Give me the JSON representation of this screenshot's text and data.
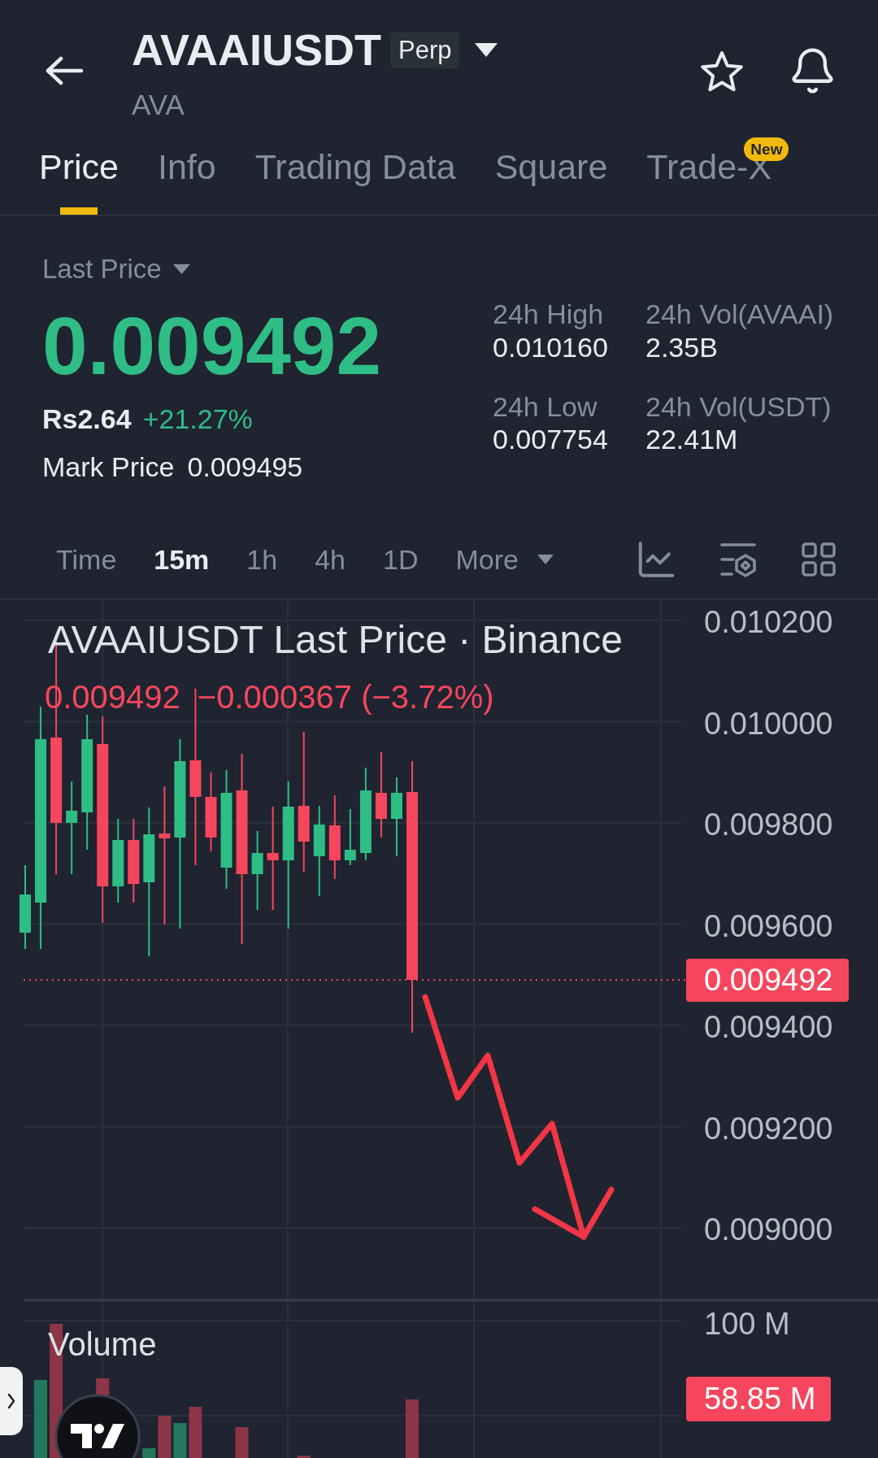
{
  "header": {
    "title": "AVAAIUSDT",
    "badge": "Perp",
    "subtitle": "AVA"
  },
  "tabs": [
    {
      "label": "Price",
      "selected": true
    },
    {
      "label": "Info",
      "selected": false
    },
    {
      "label": "Trading Data",
      "selected": false
    },
    {
      "label": "Square",
      "selected": false
    },
    {
      "label": "Trade-X",
      "selected": false,
      "badge": "New"
    }
  ],
  "price": {
    "type": "Last Price",
    "value": "0.009492",
    "fiat": "Rs2.64",
    "change": "+21.27%",
    "mark_label": "Mark Price",
    "mark_value": "0.009495"
  },
  "stats": [
    {
      "label": "24h High",
      "value": "0.010160"
    },
    {
      "label": "24h Vol(AVAAI)",
      "value": "2.35B"
    },
    {
      "label": "24h Low",
      "value": "0.007754"
    },
    {
      "label": "24h Vol(USDT)",
      "value": "22.41M"
    }
  ],
  "toolbar": {
    "label": "Time",
    "intervals": [
      {
        "label": "15m",
        "selected": true
      },
      {
        "label": "1h",
        "selected": false
      },
      {
        "label": "4h",
        "selected": false
      },
      {
        "label": "1D",
        "selected": false
      }
    ],
    "more": "More"
  },
  "chart": {
    "title": "AVAAIUSDT Last Price · Binance",
    "legend_close": "0.009492",
    "legend_change": "−0.000367 (−3.72%)",
    "price_axis": [
      "0.010200",
      "0.010000",
      "0.009800",
      "0.009600",
      "0.009400",
      "0.009200",
      "0.009000"
    ],
    "last_price_tag": "0.009492",
    "volume_title": "Volume",
    "volume_axis": [
      "100 M"
    ],
    "volume_tag": "58.85 M"
  }
}
